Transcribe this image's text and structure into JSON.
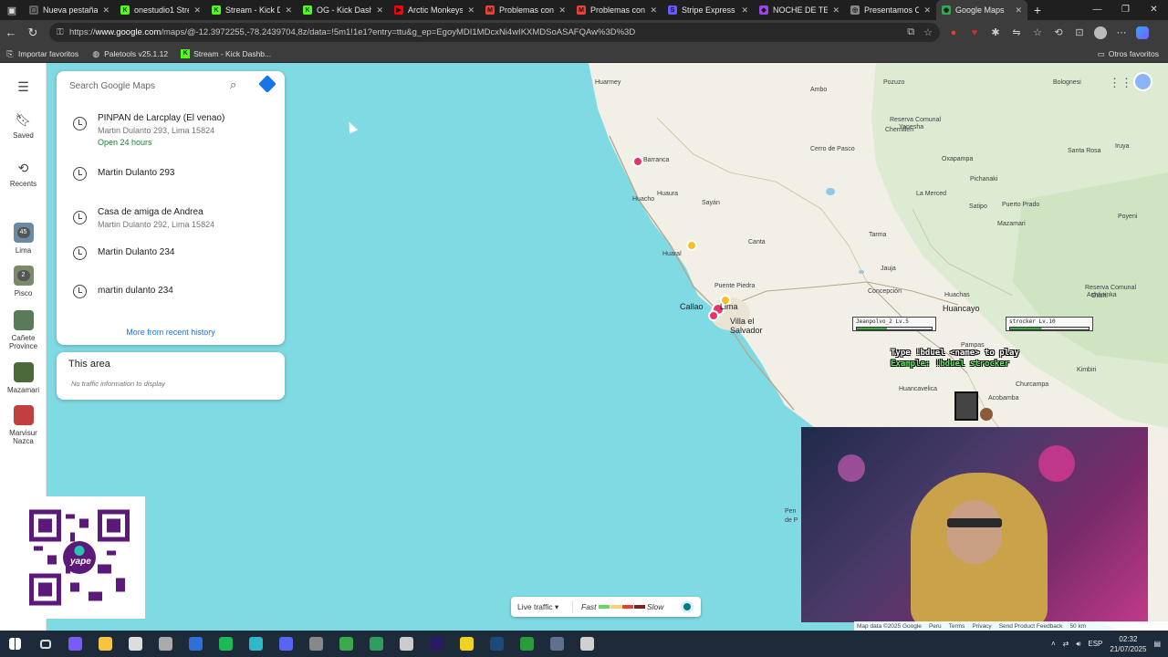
{
  "browser": {
    "tabs": [
      {
        "label": "Nueva pestaña",
        "favcolor": "#5f6368",
        "fav": "▢"
      },
      {
        "label": "onestudio1 Strea",
        "favcolor": "#53fc18",
        "fav": "K"
      },
      {
        "label": "Stream - Kick Da",
        "favcolor": "#53fc18",
        "fav": "K"
      },
      {
        "label": "OG - Kick Dashb",
        "favcolor": "#53fc18",
        "fav": "K"
      },
      {
        "label": "Arctic Monkeys",
        "favcolor": "#ff0000",
        "fav": "▶"
      },
      {
        "label": "Problemas con c",
        "favcolor": "#ea4335",
        "fav": "M"
      },
      {
        "label": "Problemas con c",
        "favcolor": "#ea4335",
        "fav": "M"
      },
      {
        "label": "Stripe Express",
        "favcolor": "#635bff",
        "fav": "S"
      },
      {
        "label": "NOCHE DE TERR",
        "favcolor": "#a142f4",
        "fav": "◆"
      },
      {
        "label": "Presentamos Ch",
        "favcolor": "#888888",
        "fav": "◎"
      },
      {
        "label": "Google Maps",
        "favcolor": "#34a853",
        "fav": "◉"
      }
    ],
    "url_prefix": "https://",
    "url_domain": "www.google.com",
    "url_rest": "/maps/@-12.3972255,-78.2439704,8z/data=!5m1!1e1?entry=ttu&g_ep=EgoyMDI1MDcxNi4wIKXMDSoASAFQAw%3D%3D",
    "bookmarks": [
      "Importar favoritos",
      "Paletools v25.1.12",
      "Stream - Kick Dashb..."
    ],
    "other_bookmarks": "Otros favoritos"
  },
  "maps": {
    "search_placeholder": "Search Google Maps",
    "rail": {
      "saved": "Saved",
      "recents": "Recents",
      "places": [
        {
          "label": "Lima",
          "badge": "45",
          "color": "#6b8ba4"
        },
        {
          "label": "Pisco",
          "badge": "2",
          "color": "#7a8a6a"
        },
        {
          "label": "Cañete Province",
          "badge": "",
          "color": "#5a7a5a"
        },
        {
          "label": "Mazamari",
          "badge": "",
          "color": "#4a6a3a"
        },
        {
          "label": "Marvisur Nazca",
          "badge": "",
          "color": "#c04040"
        }
      ]
    },
    "history": [
      {
        "title": "PINPAN de Larcplay (El venao)",
        "sub": "Martin Dulanto 293, Lima 15824",
        "open": "Open 24 hours"
      },
      {
        "title": "Martin Dulanto 293",
        "sub": "",
        "open": ""
      },
      {
        "title": "Casa de amiga de Andrea",
        "sub": "Martin Dulanto 292, Lima 15824",
        "open": ""
      },
      {
        "title": "Martin Dulanto 234",
        "sub": "",
        "open": ""
      },
      {
        "title": "martin dulanto 234",
        "sub": "",
        "open": ""
      }
    ],
    "more_history": "More from recent history",
    "area_title": "This area",
    "area_sub": "No traffic information to display",
    "map_labels": [
      {
        "text": "Huarmey",
        "cls": ""
      },
      {
        "text": "Ambo",
        "cls": ""
      },
      {
        "text": "Pozuzo",
        "cls": ""
      },
      {
        "text": "Bolognesi",
        "cls": ""
      },
      {
        "text": "Reserva Comunal",
        "cls": ""
      },
      {
        "text": "Yanesha",
        "cls": ""
      },
      {
        "text": "Chemillen",
        "cls": ""
      },
      {
        "text": "Cerro de Pasco",
        "cls": ""
      },
      {
        "text": "Oxapampa",
        "cls": ""
      },
      {
        "text": "Santa Rosa",
        "cls": ""
      },
      {
        "text": "Iruya",
        "cls": ""
      },
      {
        "text": "Barranca",
        "cls": ""
      },
      {
        "text": "Huacho",
        "cls": ""
      },
      {
        "text": "La Merced",
        "cls": ""
      },
      {
        "text": "Pichanaki",
        "cls": ""
      },
      {
        "text": "Puerto Prado",
        "cls": ""
      },
      {
        "text": "Satipo",
        "cls": ""
      },
      {
        "text": "Mazamari",
        "cls": ""
      },
      {
        "text": "Huaura",
        "cls": ""
      },
      {
        "text": "Sayán",
        "cls": ""
      },
      {
        "text": "Huaral",
        "cls": ""
      },
      {
        "text": "Tarma",
        "cls": ""
      },
      {
        "text": "Poyeni",
        "cls": ""
      },
      {
        "text": "Canta",
        "cls": ""
      },
      {
        "text": "Jauja",
        "cls": ""
      },
      {
        "text": "Puente Piedra",
        "cls": ""
      },
      {
        "text": "Concepción",
        "cls": ""
      },
      {
        "text": "Huachas",
        "cls": ""
      },
      {
        "text": "Reserva Comunal",
        "cls": ""
      },
      {
        "text": "Asháninka",
        "cls": ""
      },
      {
        "text": "Otishi",
        "cls": ""
      },
      {
        "text": "Callao",
        "cls": "big"
      },
      {
        "text": "Lima",
        "cls": "big"
      },
      {
        "text": "Huancayo",
        "cls": "big"
      },
      {
        "text": "Villa el",
        "cls": "big"
      },
      {
        "text": "Salvador",
        "cls": "big"
      },
      {
        "text": "Pampas",
        "cls": ""
      },
      {
        "text": "Huancavelica",
        "cls": ""
      },
      {
        "text": "Churcampa",
        "cls": ""
      },
      {
        "text": "Kimbiri",
        "cls": ""
      },
      {
        "text": "Acobamba",
        "cls": ""
      },
      {
        "text": "Pen",
        "cls": ""
      },
      {
        "text": "de P",
        "cls": ""
      }
    ],
    "traffic": {
      "label": "Live traffic",
      "fast": "Fast",
      "slow": "Slow"
    },
    "footer": [
      "Map data ©2025 Google",
      "Peru",
      "Terms",
      "Privacy",
      "Send Product Feedback",
      "50 km"
    ]
  },
  "overlay": {
    "player1": "Jeanpolvo_2",
    "player1_lvl": "Lv.5",
    "player2": "strocker",
    "player2_lvl": "Lv.10",
    "line1": "Type !bduel <name> to play",
    "line2": "Example: !bduel strocker",
    "qr_brand": "yape"
  },
  "taskbar": {
    "apps": [
      {
        "name": "copilot",
        "color": "#7a5af8"
      },
      {
        "name": "explorer",
        "color": "#f5c542"
      },
      {
        "name": "store",
        "color": "#dddddd"
      },
      {
        "name": "obs",
        "color": "#aaaaaa"
      },
      {
        "name": "browser-blue",
        "color": "#2f6fd8"
      },
      {
        "name": "spotify",
        "color": "#1db954"
      },
      {
        "name": "edge",
        "color": "#2fb8c8"
      },
      {
        "name": "discord",
        "color": "#5865f2"
      },
      {
        "name": "steam-like",
        "color": "#888888"
      },
      {
        "name": "app-green",
        "color": "#3ca84c"
      },
      {
        "name": "app-green2",
        "color": "#2e9e5e"
      },
      {
        "name": "capcut",
        "color": "#cccccc"
      },
      {
        "name": "premiere",
        "color": "#2a1a66"
      },
      {
        "name": "sticky",
        "color": "#f0d020"
      },
      {
        "name": "steam",
        "color": "#1b4b7a"
      },
      {
        "name": "xbox",
        "color": "#2a9a3a"
      },
      {
        "name": "calc",
        "color": "#607090"
      },
      {
        "name": "paint",
        "color": "#d0d0d0"
      }
    ],
    "lang": "ESP",
    "time": "02:32",
    "date": "21/07/2025"
  }
}
